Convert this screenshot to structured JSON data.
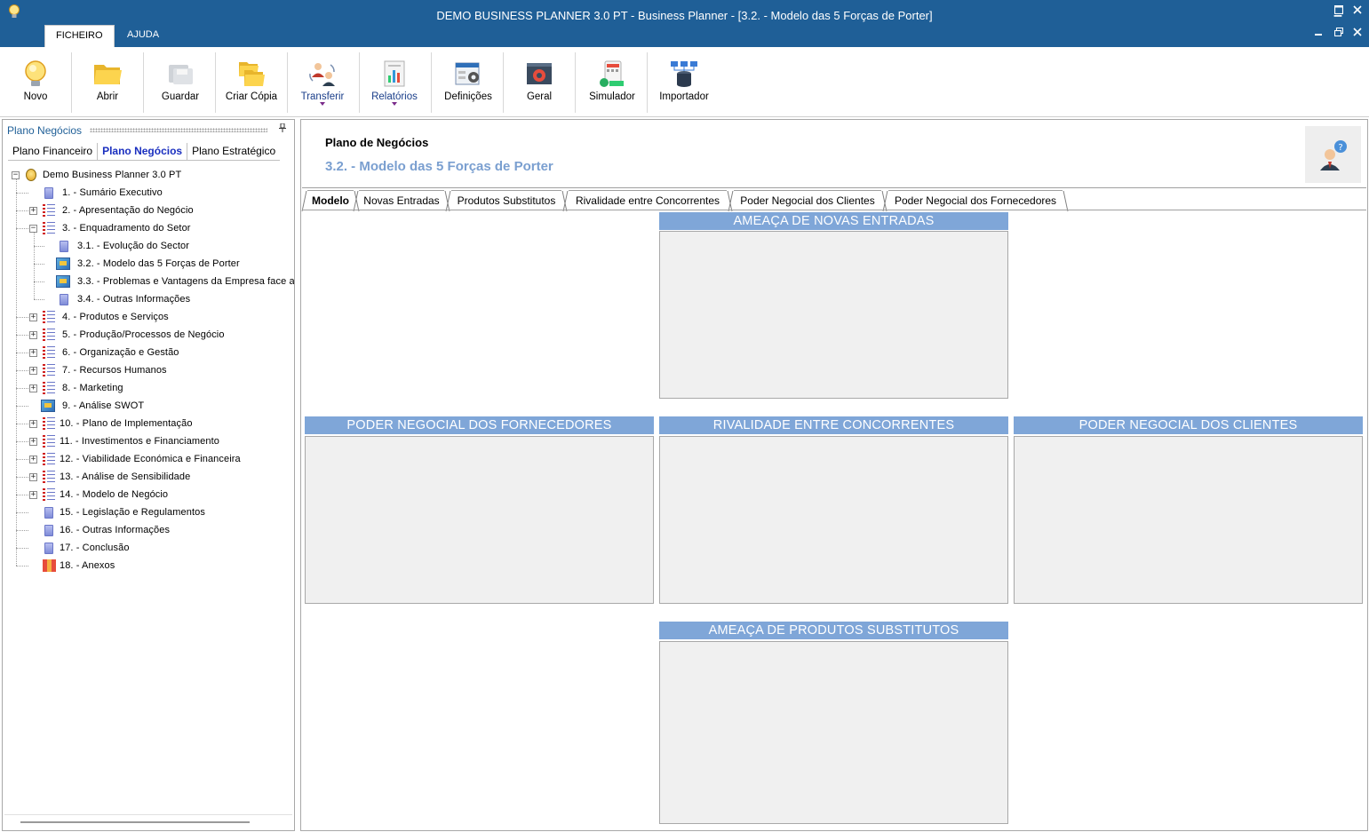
{
  "window": {
    "title": "DEMO BUSINESS PLANNER 3.0 PT - Business Planner - [3.2. - Modelo das 5 Forças de Porter]",
    "controls": [
      "minimize",
      "maximize",
      "close"
    ]
  },
  "ribbon": {
    "tabs": [
      {
        "label": "FICHEIRO",
        "active": true
      },
      {
        "label": "AJUDA",
        "active": false
      }
    ]
  },
  "toolbar": {
    "buttons": [
      {
        "label": "Novo",
        "icon": "lightbulb-icon",
        "dropdown": false
      },
      {
        "label": "Abrir",
        "icon": "folder-icon",
        "dropdown": false
      },
      {
        "label": "Guardar",
        "icon": "save-icon",
        "dropdown": false
      },
      {
        "label": "Criar Cópia",
        "icon": "copy-folder-icon",
        "dropdown": false
      },
      {
        "label": "Transferir",
        "icon": "transfer-users-icon",
        "dropdown": true
      },
      {
        "label": "Relatórios",
        "icon": "reports-icon",
        "dropdown": true
      },
      {
        "label": "Definições",
        "icon": "settings-form-icon",
        "dropdown": false
      },
      {
        "label": "Geral",
        "icon": "gear-window-icon",
        "dropdown": false
      },
      {
        "label": "Simulador",
        "icon": "calculator-icon",
        "dropdown": false
      },
      {
        "label": "Importador",
        "icon": "database-icon",
        "dropdown": false
      }
    ]
  },
  "left_pane": {
    "title": "Plano Negócios",
    "pin_icon": "pin-icon",
    "tabs": [
      {
        "label": "Plano Financeiro",
        "active": false
      },
      {
        "label": "Plano Negócios",
        "active": true
      },
      {
        "label": "Plano Estratégico",
        "active": false
      }
    ],
    "tree": [
      {
        "label": "Demo Business Planner 3.0 PT",
        "level": 0,
        "icon": "bulb",
        "expander": "minus"
      },
      {
        "label": "1. - Sumário Executivo",
        "level": 1,
        "icon": "doc",
        "expander": ""
      },
      {
        "label": "2. - Apresentação do Negócio",
        "level": 1,
        "icon": "list",
        "expander": "plus"
      },
      {
        "label": "3. - Enquadramento do Setor",
        "level": 1,
        "icon": "list",
        "expander": "minus"
      },
      {
        "label": "3.1. - Evolução do Sector",
        "level": 2,
        "icon": "doc",
        "expander": ""
      },
      {
        "label": "3.2. - Modelo das 5 Forças de Porter",
        "level": 2,
        "icon": "chart",
        "expander": ""
      },
      {
        "label": "3.3. - Problemas e Vantagens da Empresa face a",
        "level": 2,
        "icon": "chart",
        "expander": ""
      },
      {
        "label": "3.4. - Outras Informações",
        "level": 2,
        "icon": "doc",
        "expander": ""
      },
      {
        "label": "4. - Produtos e Serviços",
        "level": 1,
        "icon": "list",
        "expander": "plus"
      },
      {
        "label": "5. - Produção/Processos de Negócio",
        "level": 1,
        "icon": "list",
        "expander": "plus"
      },
      {
        "label": "6. - Organização e Gestão",
        "level": 1,
        "icon": "list",
        "expander": "plus"
      },
      {
        "label": "7. - Recursos Humanos",
        "level": 1,
        "icon": "list",
        "expander": "plus"
      },
      {
        "label": "8. - Marketing",
        "level": 1,
        "icon": "list",
        "expander": "plus"
      },
      {
        "label": "9. - Análise SWOT",
        "level": 1,
        "icon": "chart",
        "expander": ""
      },
      {
        "label": "10. - Plano de Implementação",
        "level": 1,
        "icon": "list",
        "expander": "plus"
      },
      {
        "label": "11. - Investimentos e Financiamento",
        "level": 1,
        "icon": "list",
        "expander": "plus"
      },
      {
        "label": "12. - Viabilidade Económica e Financeira",
        "level": 1,
        "icon": "list",
        "expander": "plus"
      },
      {
        "label": "13. - Análise de Sensibilidade",
        "level": 1,
        "icon": "list",
        "expander": "plus"
      },
      {
        "label": "14. - Modelo de Negócio",
        "level": 1,
        "icon": "list",
        "expander": "plus"
      },
      {
        "label": "15. - Legislação e Regulamentos",
        "level": 1,
        "icon": "doc",
        "expander": ""
      },
      {
        "label": "16. - Outras Informações",
        "level": 1,
        "icon": "doc",
        "expander": ""
      },
      {
        "label": "17. - Conclusão",
        "level": 1,
        "icon": "doc",
        "expander": ""
      },
      {
        "label": "18. - Anexos",
        "level": 1,
        "icon": "annex",
        "expander": ""
      }
    ]
  },
  "content": {
    "section": "Plano de Negócios",
    "subtitle": "3.2. - Modelo das 5 Forças de Porter",
    "help_icon": "help-user-icon",
    "tabs": [
      {
        "label": "Modelo",
        "active": true
      },
      {
        "label": "Novas Entradas",
        "active": false
      },
      {
        "label": "Produtos Substitutos",
        "active": false
      },
      {
        "label": "Rivalidade entre Concorrentes",
        "active": false
      },
      {
        "label": "Poder Negocial dos Clientes",
        "active": false
      },
      {
        "label": "Poder Negocial dos Fornecedores",
        "active": false
      }
    ],
    "panels": {
      "new_entrants": "AMEAÇA DE NOVAS ENTRADAS",
      "suppliers": "PODER NEGOCIAL DOS FORNECEDORES",
      "rivalry": "RIVALIDADE ENTRE CONCORRENTES",
      "clients": "PODER NEGOCIAL DOS CLIENTES",
      "substitutes": "AMEAÇA DE PRODUTOS SUBSTITUTOS"
    }
  },
  "colors": {
    "titlebar": "#1f5f97",
    "panel_header": "#7fa6d8",
    "panel_body": "#f0f0f0",
    "subtitle": "#7a9fd0",
    "active_left_tab": "#1a2fbf"
  }
}
